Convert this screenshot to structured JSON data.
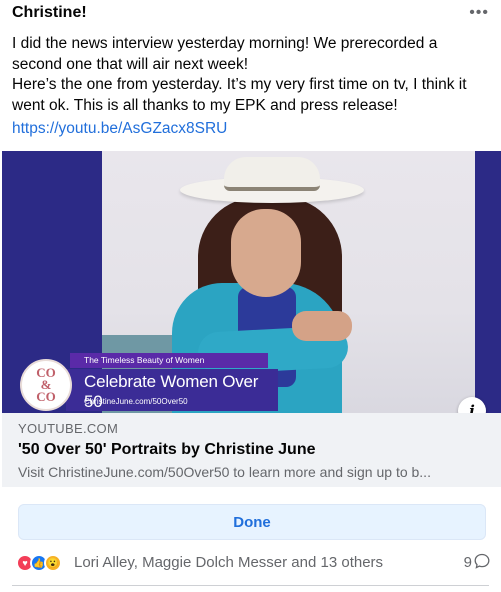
{
  "post": {
    "author": "Christine!",
    "more_icon": "•••",
    "text_line1": "I did the news interview yesterday morning!  We prerecorded a second one that will air next week!",
    "text_line2": "Here’s the one from yesterday.  It’s my very first time on tv, I think it went ok. This is all thanks to my EPK and press release!",
    "link": "https://youtu.be/AsGZacx8SRU"
  },
  "preview": {
    "banner_tag": "The Timeless Beauty of Women",
    "banner_title": "Celebrate Women Over 50",
    "banner_url": "ChristineJune.com/50Over50",
    "logo_text": "CO\n&\nCO",
    "info_icon": "i"
  },
  "link_card": {
    "domain": "YOUTUBE.COM",
    "title": "'50 Over 50' Portraits by Christine June",
    "description": "Visit ChristineJune.com/50Over50 to learn more and sign up to b..."
  },
  "actions": {
    "done_label": "Done"
  },
  "reactions": {
    "icons": [
      "love-icon",
      "like-icon",
      "wow-icon"
    ],
    "names": "Lori Alley, Maggie Dolch Messer and 13 others",
    "comment_count": "9"
  }
}
